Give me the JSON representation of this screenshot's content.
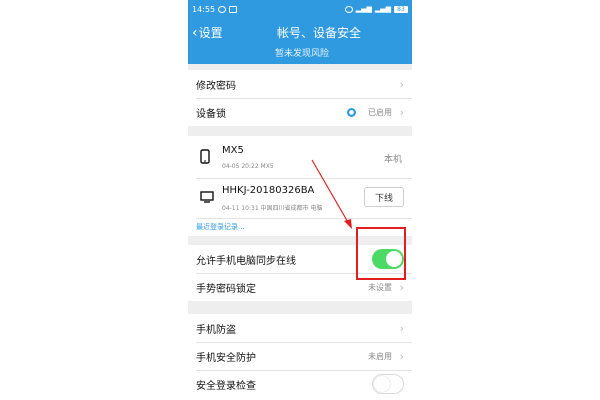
{
  "status_bar": {
    "time": "14:55",
    "battery": "83"
  },
  "header": {
    "back_label": "设置",
    "title": "帐号、设备安全",
    "subtitle": "暂未发现风险"
  },
  "settings": {
    "change_password": "修改密码",
    "device_lock": "设备锁",
    "device_lock_status": "已启用"
  },
  "devices": [
    {
      "name": "MX5",
      "detail": "04-05 20:22 MX5",
      "status": "本机",
      "icon": "phone-icon"
    },
    {
      "name": "HHKJ-20180326BA",
      "detail": "04-11 10:31 中国四川省成都市 电脑",
      "action": "下线",
      "icon": "monitor-icon"
    }
  ],
  "recent_login_link": "最近登录记录...",
  "sync_online": {
    "label": "允许手机电脑同步在线",
    "enabled": true
  },
  "gesture_lock": {
    "label": "手势密码锁定",
    "status": "未设置"
  },
  "phone_guard": {
    "label": "手机防盗"
  },
  "phone_protect": {
    "label": "手机安全防护",
    "status": "未启用"
  },
  "login_check": {
    "label": "安全登录检查",
    "enabled": false
  },
  "colors": {
    "accent": "#2f9ae0",
    "toggle_on": "#4cd964",
    "annotation": "#e02020"
  }
}
